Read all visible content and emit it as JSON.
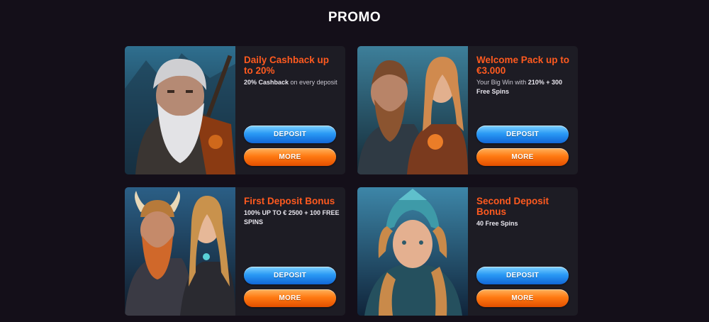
{
  "header": {
    "title": "PROMO"
  },
  "promos": [
    {
      "title": "Daily Cashback up to 20%",
      "desc_bold": "20% Cashback",
      "desc_rest": " on every deposit",
      "art": "old-viking-warrior-illustration",
      "deposit_label": "DEPOSIT",
      "more_label": "MORE"
    },
    {
      "title": "Welcome Pack up to €3.000",
      "desc_lead": "Your Big Win with ",
      "desc_bold": "210% + 300 Free Spins",
      "art": "viking-couple-illustration",
      "deposit_label": "DEPOSIT",
      "more_label": "MORE"
    },
    {
      "title": "First Deposit Bonus",
      "desc_bold": "100% UP TO € 2500 + 100 FREE SPINS",
      "art": "horned-viking-and-woman-illustration",
      "deposit_label": "DEPOSIT",
      "more_label": "MORE"
    },
    {
      "title": "Second Deposit Bonus",
      "desc_bold": "40 Free Spins",
      "art": "valkyrie-illustration",
      "deposit_label": "DEPOSIT",
      "more_label": "MORE"
    }
  ],
  "colors": {
    "background": "#140f19",
    "card": "#1d1c24",
    "accent_title": "#ff5a1f",
    "deposit_button": "#2a9af5",
    "more_button": "#ff7a12"
  }
}
